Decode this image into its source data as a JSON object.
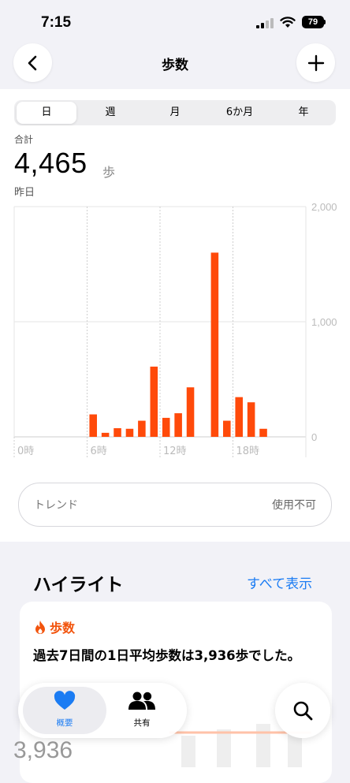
{
  "status": {
    "time": "7:15",
    "battery": "79"
  },
  "nav": {
    "title": "歩数"
  },
  "segments": [
    {
      "label": "日",
      "active": true
    },
    {
      "label": "週",
      "active": false
    },
    {
      "label": "月",
      "active": false
    },
    {
      "label": "6か月",
      "active": false
    },
    {
      "label": "年",
      "active": false
    }
  ],
  "summary": {
    "label": "合計",
    "value": "4,465",
    "unit": "歩",
    "date": "昨日"
  },
  "chart_data": {
    "type": "bar",
    "x_ticks": [
      {
        "hour": 0,
        "label": "0時"
      },
      {
        "hour": 6,
        "label": "6時"
      },
      {
        "hour": 12,
        "label": "12時"
      },
      {
        "hour": 18,
        "label": "18時"
      }
    ],
    "y_ticks": [
      {
        "value": 2000,
        "label": "2,000"
      },
      {
        "value": 1000,
        "label": "1,000"
      },
      {
        "value": 0,
        "label": "0"
      }
    ],
    "ylim": [
      0,
      2000
    ],
    "xlim": [
      0,
      24
    ],
    "bar_color": "#ff4a0a",
    "points": [
      {
        "hour": 6,
        "value": 195
      },
      {
        "hour": 7,
        "value": 35
      },
      {
        "hour": 8,
        "value": 75
      },
      {
        "hour": 9,
        "value": 70
      },
      {
        "hour": 10,
        "value": 140
      },
      {
        "hour": 11,
        "value": 610
      },
      {
        "hour": 12,
        "value": 165
      },
      {
        "hour": 13,
        "value": 205
      },
      {
        "hour": 14,
        "value": 430
      },
      {
        "hour": 16,
        "value": 1600
      },
      {
        "hour": 17,
        "value": 140
      },
      {
        "hour": 18,
        "value": 345
      },
      {
        "hour": 19,
        "value": 300
      },
      {
        "hour": 20,
        "value": 70
      }
    ]
  },
  "trend": {
    "label": "トレンド",
    "value": "使用不可"
  },
  "highlights": {
    "title": "ハイライト",
    "show_all": "すべて表示",
    "card": {
      "category": "歩数",
      "text": "過去7日間の1日平均歩数は3,936歩でした。",
      "value": "3,936"
    }
  },
  "tabs": [
    {
      "label": "概要",
      "active": true,
      "icon": "heart-icon"
    },
    {
      "label": "共有",
      "active": false,
      "icon": "people-icon"
    }
  ],
  "colors": {
    "accent": "#1b7cf3",
    "steps": "#f2540d",
    "bar": "#ff4a0a"
  }
}
